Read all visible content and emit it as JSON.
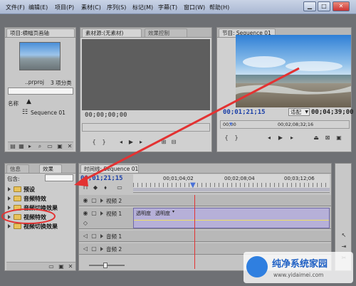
{
  "menu": [
    "文件(F)",
    "编辑(E)",
    "项目(P)",
    "素材(C)",
    "序列(S)",
    "标记(M)",
    "字幕(T)",
    "窗口(W)",
    "帮助(H)"
  ],
  "window_buttons": [
    "▁",
    "□",
    "✕"
  ],
  "project": {
    "tab_label": "项目:横幅页画轴",
    "filename": "..prproj",
    "count": "3 项分类",
    "column_name": "名称",
    "item": "Sequence 01"
  },
  "source": {
    "tab_source": "素材源:(无素材)",
    "tab_effects_ctrl": "效果控制",
    "timecode": "00;00;00;00"
  },
  "program": {
    "tab_label": "节目: Sequence 01",
    "current_tc": "00;01;21;15",
    "fit": "适配",
    "duration_tc": "00;04;39;00",
    "ruler_start": "00;00",
    "ruler_mid": "00;02;08;32;16"
  },
  "effects": {
    "tab_info": "信息",
    "tab_effects": "效果",
    "search_label": "包含:",
    "folders": [
      "预设",
      "音频特效",
      "音频切换效果",
      "视频特效",
      "视频切换效果"
    ]
  },
  "timeline": {
    "tab_label": "时间线: Sequence 01",
    "current_tc": "00;01;21;15",
    "ruler": [
      "00;01;04;02",
      "00;02;08;04",
      "00;03;12;06"
    ],
    "tracks": {
      "v2": "视频 2",
      "v1": "视频 1",
      "a1": "音频 1",
      "a2": "音频 2"
    },
    "clip_label": "透明度",
    "clip_mode": "透明度"
  },
  "watermark": {
    "title": "纯净系统家园",
    "url": "www.yidaimei.com"
  },
  "colors": {
    "annotation_red": "#e33232",
    "timecode_blue": "#1a3fa8",
    "playhead": "#4a72d8"
  }
}
